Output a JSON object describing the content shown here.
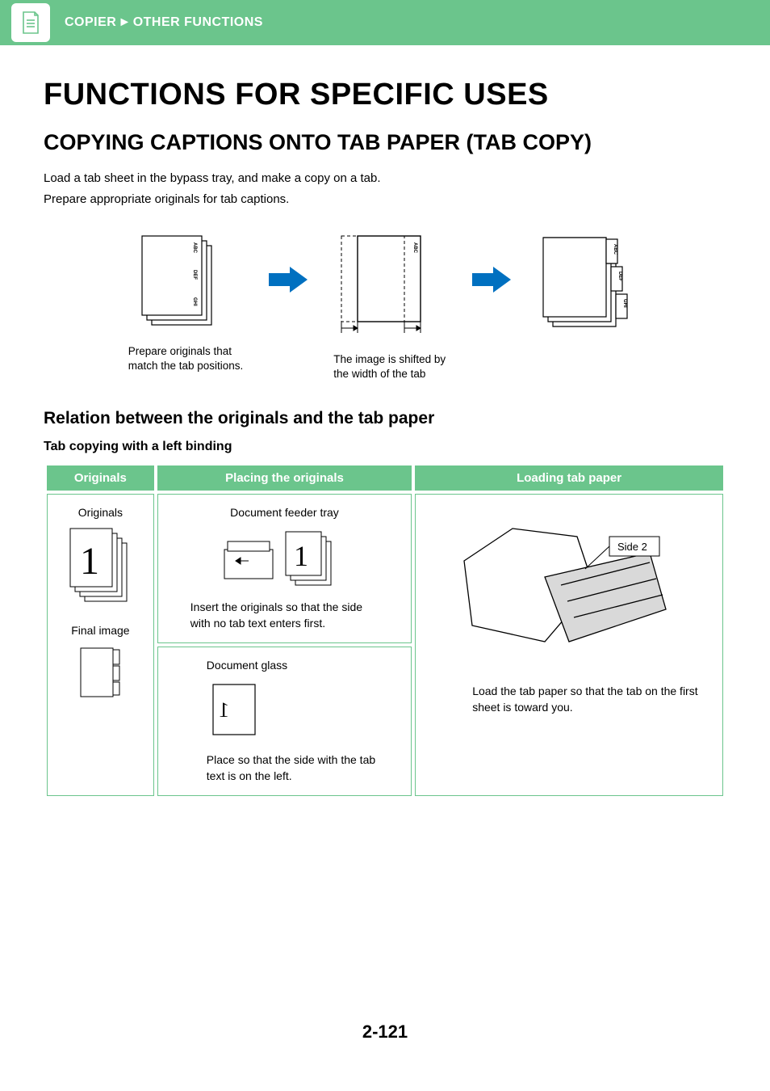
{
  "header": {
    "breadcrumb_part1": "COPIER",
    "breadcrumb_part2": "OTHER FUNCTIONS"
  },
  "h1": "FUNCTIONS FOR SPECIFIC USES",
  "h2": "COPYING CAPTIONS ONTO TAB PAPER (TAB COPY)",
  "intro1": "Load a tab sheet in the bypass tray, and make a copy on a tab.",
  "intro2": "Prepare appropriate originals for tab captions.",
  "diagram": {
    "tab_labels": [
      "ABC",
      "DEF",
      "GHI"
    ],
    "caption1_line1": "Prepare originals that",
    "caption1_line2": "match the tab positions.",
    "caption2_line1": "The image is shifted by",
    "caption2_line2": "the width of the tab"
  },
  "h3": "Relation between the originals and the tab paper",
  "h4": "Tab copying with a left binding",
  "table": {
    "headers": {
      "originals": "Originals",
      "placing": "Placing the originals",
      "loading": "Loading tab paper"
    },
    "col_originals": {
      "label1": "Originals",
      "big_one": "1",
      "label2": "Final image"
    },
    "col_placing_top": {
      "title": "Document feeder tray",
      "text": "Insert the originals so that the side with no tab text enters first."
    },
    "col_placing_bottom": {
      "title": "Document glass",
      "text": "Place so that the side with the tab text is on the left."
    },
    "col_loading": {
      "side_label": "Side 2",
      "text": "Load the tab paper so that the tab on the first sheet is toward you."
    }
  },
  "page_number": "2-121"
}
